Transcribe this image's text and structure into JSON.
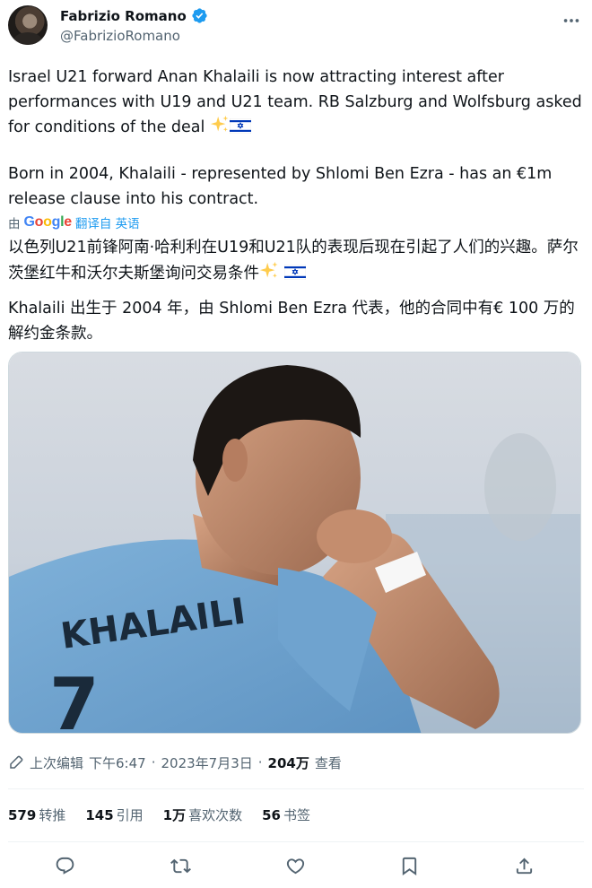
{
  "author": {
    "name": "Fabrizio Romano",
    "handle": "@FabrizioRomano",
    "verified_color": "#1d9bf0"
  },
  "tweet": {
    "paragraph1": "Israel U21 forward Anan Khalaili is now attracting interest after performances with U19 and U21 team. RB Salzburg and Wolfsburg asked for conditions of the deal",
    "paragraph2": "Born in 2004, Khalaili - represented by Shlomi Ben Ezra - has an €1m release clause into his contract."
  },
  "translation": {
    "by_label": "由",
    "google_label": "Google",
    "link_label": "翻译自 英语",
    "paragraph1": "以色列U21前锋阿南·哈利利在U19和U21队的表现后现在引起了人们的兴趣。萨尔茨堡红牛和沃尔夫斯堡询问交易条件",
    "paragraph2": "Khalaili 出生于 2004 年，由 Shlomi Ben Ezra 代表，他的合同中有€ 100 万的解约金条款。"
  },
  "photo": {
    "jersey_text": "KHALAILI",
    "jersey_number": "7"
  },
  "meta": {
    "edited_label": "上次编辑",
    "time": "下午6:47",
    "separator": "·",
    "date": "2023年7月3日",
    "views_count": "204万",
    "views_label": "查看"
  },
  "stats": {
    "retweets_count": "579",
    "retweets_label": "转推",
    "quotes_count": "145",
    "quotes_label": "引用",
    "likes_count": "1万",
    "likes_label": "喜欢次数",
    "bookmarks_count": "56",
    "bookmarks_label": "书签"
  },
  "icons": {
    "more": "more-horizontal-icon",
    "reply": "reply-icon",
    "retweet": "retweet-icon",
    "like": "like-icon",
    "bookmark": "bookmark-icon",
    "share": "share-icon",
    "edit": "edit-pencil-icon"
  }
}
